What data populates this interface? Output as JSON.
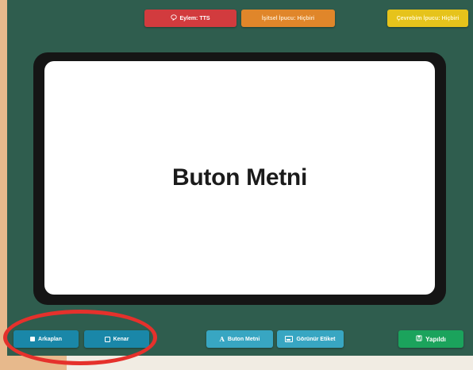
{
  "top_bar": {
    "action_label": "Eylem: TTS",
    "hint_label": "İşitsel İpucu: Hiçbiri",
    "response_label": "Çevrebim İpucu: Hiçbiri"
  },
  "device_screen": {
    "text": "Buton Metni"
  },
  "bottom_toolbar": {
    "background_label": "Arkaplan",
    "border_label": "Kenar",
    "button_text_label": "Buton Metni",
    "visible_label": "Görünür Etiket",
    "done_label": "Yapıldı"
  },
  "colors": {
    "page_background": "#2f5d4e",
    "action_button": "#d23b3e",
    "hint_button": "#e0862a",
    "response_button": "#e6c31b",
    "toolbar_button": "#1a87a8",
    "done_button": "#1ba35c",
    "annotation": "#e5312c"
  },
  "icons": {
    "action": "speech-bubble-icon",
    "background": "filled-square-icon",
    "border": "outline-square-icon",
    "button_text": "text-icon",
    "visible_label": "image-icon",
    "done": "save-icon"
  }
}
